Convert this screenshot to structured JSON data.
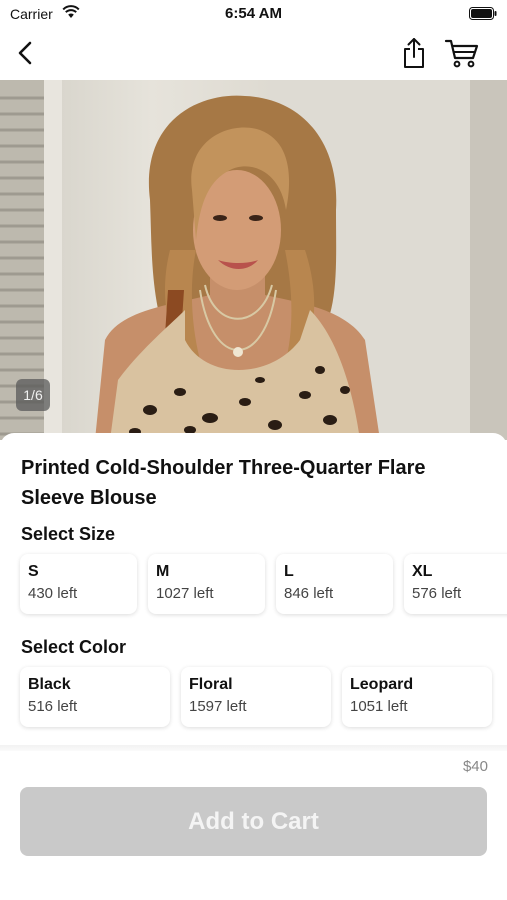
{
  "status_bar": {
    "carrier": "Carrier",
    "time": "6:54 AM"
  },
  "nav": {
    "back_icon": "chevron-left-icon",
    "share_icon": "share-icon",
    "cart_icon": "cart-icon"
  },
  "gallery": {
    "page_indicator": "1/6"
  },
  "product": {
    "title": "Printed Cold-Shoulder Three-Quarter Flare Sleeve Blouse",
    "price": "$40"
  },
  "size_section": {
    "label": "Select Size",
    "options": [
      {
        "name": "S",
        "stock": "430 left"
      },
      {
        "name": "M",
        "stock": "1027 left"
      },
      {
        "name": "L",
        "stock": "846 left"
      },
      {
        "name": "XL",
        "stock": "576 left"
      }
    ]
  },
  "color_section": {
    "label": "Select Color",
    "options": [
      {
        "name": "Black",
        "stock": "516 left"
      },
      {
        "name": "Floral",
        "stock": "1597 left"
      },
      {
        "name": "Leopard",
        "stock": "1051 left"
      }
    ]
  },
  "actions": {
    "add_to_cart": "Add to Cart"
  },
  "colors": {
    "button_disabled_bg": "#c9c9c9",
    "price_text": "#888888"
  }
}
